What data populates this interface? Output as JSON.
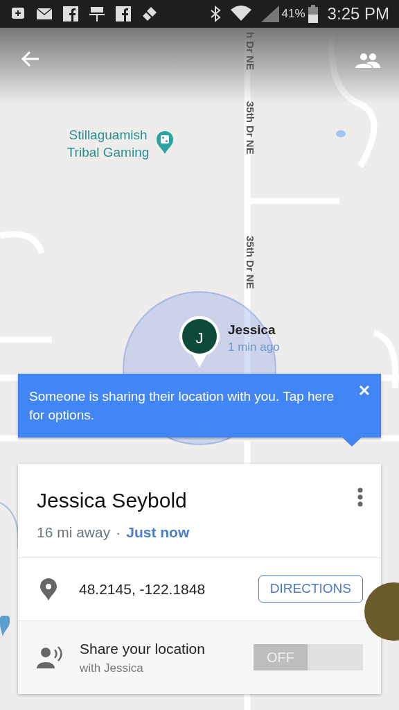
{
  "status_bar": {
    "battery": "41%",
    "time": "3:25 PM"
  },
  "map": {
    "place": {
      "name": "Stillaguamish Tribal Gaming"
    },
    "roads": [
      {
        "name": "h Dr NE"
      },
      {
        "name": "35th Dr NE"
      },
      {
        "name": "35th Dr NE"
      }
    ],
    "person": {
      "initial": "J",
      "name": "Jessica",
      "updated": "1 min ago"
    }
  },
  "banner": {
    "text": "Someone is sharing their location with you. Tap here for options."
  },
  "card": {
    "name": "Jessica Seybold",
    "distance": "16 mi away",
    "separator": "·",
    "updated": "Just now",
    "coordinates": "48.2145, -122.1848",
    "directions": "DIRECTIONS",
    "share": {
      "title": "Share your location",
      "subtitle": "with Jessica",
      "toggle_label": "OFF",
      "on": false
    }
  }
}
